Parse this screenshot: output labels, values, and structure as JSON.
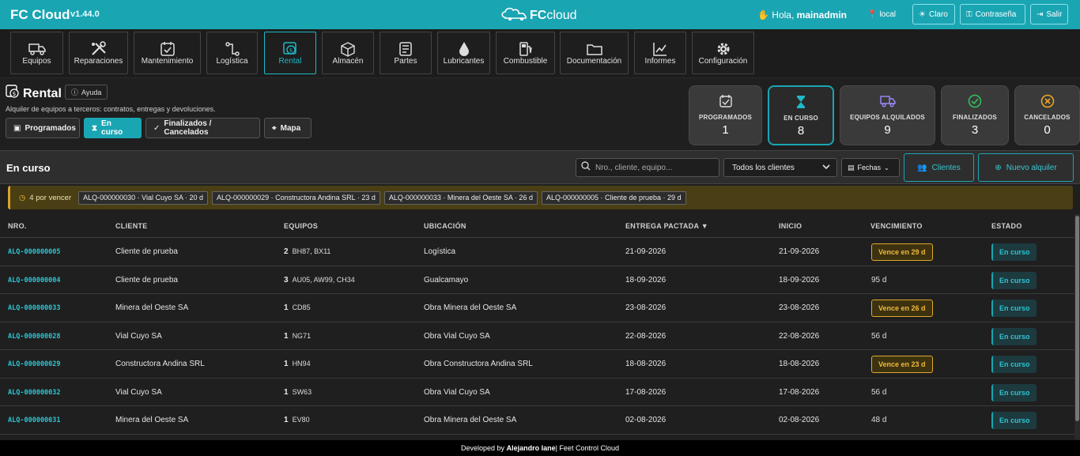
{
  "app": {
    "brand": "FC Cloud",
    "version": "v1.44.0",
    "logo_fc": "FC",
    "logo_cloud": "cloud"
  },
  "user": {
    "greeting": "Hola, ",
    "name": "mainadmin",
    "location": "local"
  },
  "top_buttons": {
    "theme": "Claro",
    "password": "Contraseña",
    "logout": "Salir"
  },
  "modules": [
    {
      "label": "Equipos",
      "icon": "truck-icon"
    },
    {
      "label": "Reparaciones",
      "icon": "tools-icon"
    },
    {
      "label": "Mantenimiento",
      "icon": "calendar-check-icon"
    },
    {
      "label": "Logística",
      "icon": "route-icon"
    },
    {
      "label": "Rental",
      "icon": "rental-icon",
      "active": true
    },
    {
      "label": "Almacén",
      "icon": "box-icon"
    },
    {
      "label": "Partes",
      "icon": "parts-list-icon"
    },
    {
      "label": "Lubricantes",
      "icon": "drop-icon"
    },
    {
      "label": "Combustible",
      "icon": "fuel-pump-icon"
    },
    {
      "label": "Documentación",
      "icon": "folder-icon"
    },
    {
      "label": "Informes",
      "icon": "chart-line-icon"
    },
    {
      "label": "Configuración",
      "icon": "gear-icon"
    }
  ],
  "page": {
    "title": "Rental",
    "help": "Ayuda",
    "subtitle": "Alquiler de equipos a terceros: contratos, entregas y devoluciones.",
    "filter_tabs": [
      {
        "label": "Programados"
      },
      {
        "label": "En curso",
        "active": true
      },
      {
        "label": "Finalizados / Cancelados"
      },
      {
        "label": "Mapa"
      }
    ]
  },
  "stats": [
    {
      "label": "PROGRAMADOS",
      "value": "1",
      "color": "#e0e0e0"
    },
    {
      "label": "EN CURSO",
      "value": "8",
      "color": "#1fb8c6",
      "active": true
    },
    {
      "label": "EQUIPOS ALQUILADOS",
      "value": "9",
      "color": "#9b8cff"
    },
    {
      "label": "FINALIZADOS",
      "value": "3",
      "color": "#33c15a"
    },
    {
      "label": "CANCELADOS",
      "value": "0",
      "color": "#f0a91c"
    }
  ],
  "list": {
    "title": "En curso",
    "search_placeholder": "Nro., cliente, equipo...",
    "client_filter": "Todos los clientes",
    "dates": "Fechas",
    "clients_btn": "Clientes",
    "new_btn": "Nuevo alquiler"
  },
  "alert": {
    "count": "4 por vencer",
    "chips": [
      "ALQ-000000030 · Vial Cuyo SA · 20 d",
      "ALQ-000000029 · Constructora Andina SRL · 23 d",
      "ALQ-000000033 · Minera del Oeste SA · 26 d",
      "ALQ-000000005 · Cliente de prueba · 29 d"
    ]
  },
  "table": {
    "headers": [
      "NRO.",
      "CLIENTE",
      "EQUIPOS",
      "UBICACIÓN",
      "ENTREGA PACTADA ▼",
      "INICIO",
      "VENCIMIENTO",
      "ESTADO"
    ],
    "rows": [
      {
        "nro": "ALQ-000000005",
        "cliente": "Cliente de prueba",
        "count": "2",
        "equipos": "BH87, BX11",
        "ubicacion": "Logística",
        "entrega": "21-09-2026",
        "inicio": "21-09-2026",
        "venc": "Vence en 29 d",
        "warn": true,
        "estado": "En curso"
      },
      {
        "nro": "ALQ-000000004",
        "cliente": "Cliente de prueba",
        "count": "3",
        "equipos": "AU05, AW99, CH34",
        "ubicacion": "Gualcamayo",
        "entrega": "18-09-2026",
        "inicio": "18-09-2026",
        "venc": "95 d",
        "warn": false,
        "estado": "En curso"
      },
      {
        "nro": "ALQ-000000033",
        "cliente": "Minera del Oeste SA",
        "count": "1",
        "equipos": "CD85",
        "ubicacion": "Obra Minera del Oeste SA",
        "entrega": "23-08-2026",
        "inicio": "23-08-2026",
        "venc": "Vence en 26 d",
        "warn": true,
        "estado": "En curso"
      },
      {
        "nro": "ALQ-000000028",
        "cliente": "Vial Cuyo SA",
        "count": "1",
        "equipos": "NG71",
        "ubicacion": "Obra Vial Cuyo SA",
        "entrega": "22-08-2026",
        "inicio": "22-08-2026",
        "venc": "56 d",
        "warn": false,
        "estado": "En curso"
      },
      {
        "nro": "ALQ-000000029",
        "cliente": "Constructora Andina SRL",
        "count": "1",
        "equipos": "HN94",
        "ubicacion": "Obra Constructora Andina SRL",
        "entrega": "18-08-2026",
        "inicio": "18-08-2026",
        "venc": "Vence en 23 d",
        "warn": true,
        "estado": "En curso"
      },
      {
        "nro": "ALQ-000000032",
        "cliente": "Vial Cuyo SA",
        "count": "1",
        "equipos": "SW63",
        "ubicacion": "Obra Vial Cuyo SA",
        "entrega": "17-08-2026",
        "inicio": "17-08-2026",
        "venc": "56 d",
        "warn": false,
        "estado": "En curso"
      },
      {
        "nro": "ALQ-000000031",
        "cliente": "Minera del Oeste SA",
        "count": "1",
        "equipos": "EV80",
        "ubicacion": "Obra Minera del Oeste SA",
        "entrega": "02-08-2026",
        "inicio": "02-08-2026",
        "venc": "48 d",
        "warn": false,
        "estado": "En curso"
      }
    ]
  },
  "footer": {
    "prefix": "Developed by ",
    "author": "Alejandro Iane",
    "suffix": " | Feet Control Cloud"
  }
}
